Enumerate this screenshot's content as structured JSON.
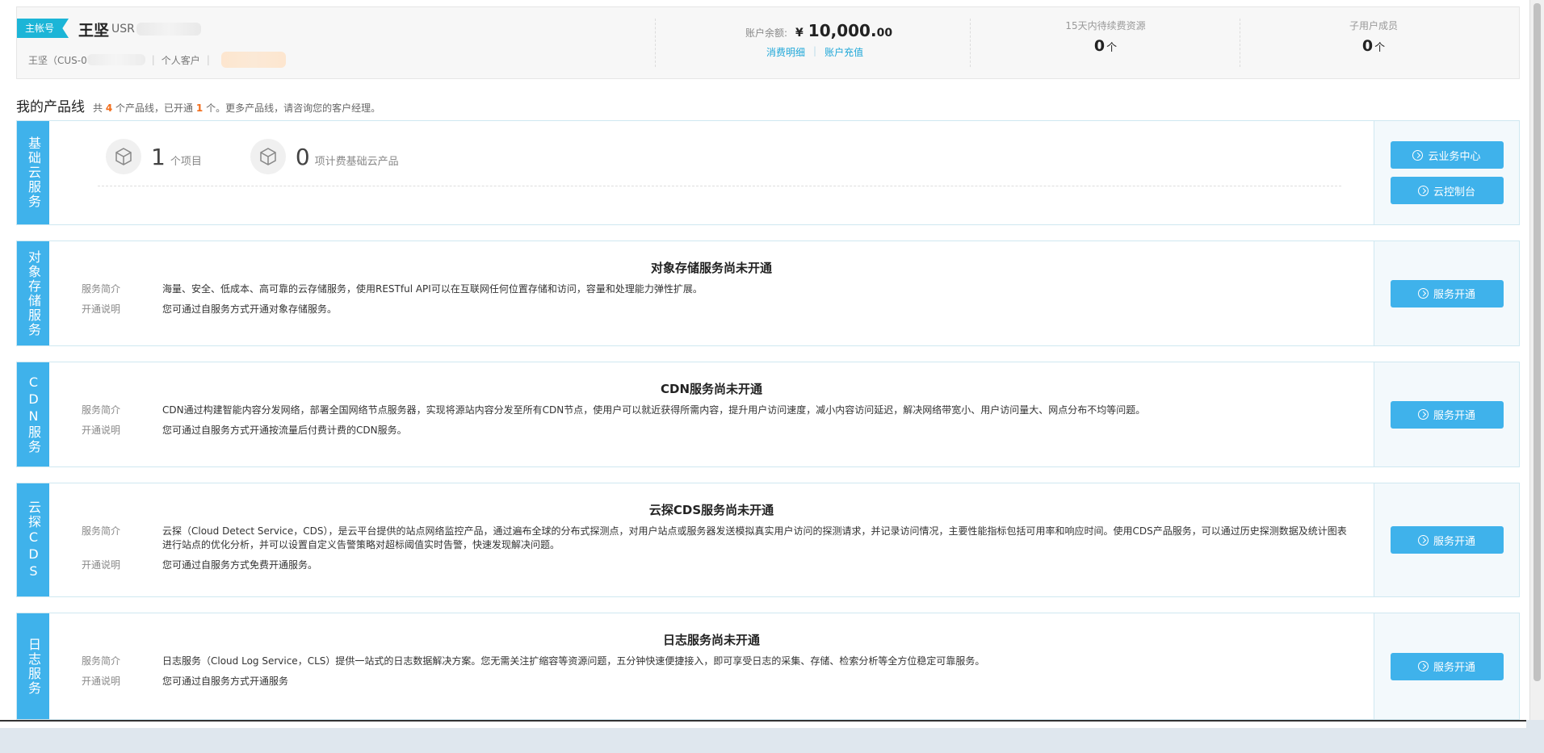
{
  "account": {
    "badge": "主帐号",
    "name": "王坚",
    "usr_prefix": "USR",
    "sub_name": "王坚（CUS-0",
    "customer_type": "个人客户",
    "balance_label": "账户余额:",
    "currency": "¥",
    "balance_int": "10,000.",
    "balance_dec": "00",
    "link_details": "消费明细",
    "link_recharge": "账户充值",
    "renew_label": "15天内待续费资源",
    "renew_count": "0",
    "renew_unit": "个",
    "subusers_label": "子用户成员",
    "subusers_count": "0",
    "subusers_unit": "个"
  },
  "product_lines": {
    "title": "我的产品线",
    "note_prefix": "共",
    "total": "4",
    "note_mid": "个产品线，已开通",
    "opened": "1",
    "note_suffix": "个。更多产品线，请咨询您的客户经理。"
  },
  "basic": {
    "side": "基础云服务",
    "projects_count": "1",
    "projects_label": "个项目",
    "items_count": "0",
    "items_label": "项计费基础云产品",
    "btn_business_center": "云业务中心",
    "btn_console": "云控制台"
  },
  "labels": {
    "intro": "服务简介",
    "open_note": "开通说明",
    "btn_open": "服务开通"
  },
  "services": [
    {
      "side": "对象存储服务",
      "title": "对象存储服务尚未开通",
      "intro": "海量、安全、低成本、高可靠的云存储服务，使用RESTful API可以在互联网任何位置存储和访问，容量和处理能力弹性扩展。",
      "note": "您可通过自服务方式开通对象存储服务。"
    },
    {
      "side": "CDN服务",
      "title": "CDN服务尚未开通",
      "intro": "CDN通过构建智能内容分发网络，部署全国网络节点服务器，实现将源站内容分发至所有CDN节点，使用户可以就近获得所需内容，提升用户访问速度，减小内容访问延迟，解决网络带宽小、用户访问量大、网点分布不均等问题。",
      "note": "您可通过自服务方式开通按流量后付费计费的CDN服务。"
    },
    {
      "side": "云探CDS",
      "title": "云探CDS服务尚未开通",
      "intro": "云探（Cloud Detect Service，CDS），是云平台提供的站点网络监控产品，通过遍布全球的分布式探测点，对用户站点或服务器发送模拟真实用户访问的探测请求，并记录访问情况，主要性能指标包括可用率和响应时间。使用CDS产品服务，可以通过历史探测数据及统计图表进行站点的优化分析，并可以设置自定义告警策略对超标阈值实时告警，快速发现解决问题。",
      "note": "您可通过自服务方式免费开通服务。"
    },
    {
      "side": "日志服务",
      "title": "日志服务尚未开通",
      "intro": "日志服务（Cloud Log Service，CLS）提供一站式的日志数据解决方案。您无需关注扩缩容等资源问题，五分钟快速便捷接入，即可享受日志的采集、存储、检索分析等全方位稳定可靠服务。",
      "note": "您可通过自服务方式开通服务"
    }
  ]
}
